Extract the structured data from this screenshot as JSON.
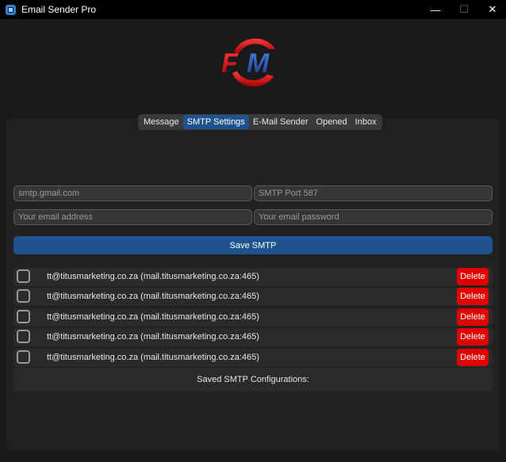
{
  "window": {
    "title": "Email Sender Pro",
    "minimize": "—",
    "maximize": "☐",
    "close": "✕"
  },
  "logo": {
    "text": "FM"
  },
  "tabs": [
    {
      "label": "Message"
    },
    {
      "label": "SMTP Settings"
    },
    {
      "label": "E-Mail Sender"
    },
    {
      "label": "Opened"
    },
    {
      "label": "Inbox"
    }
  ],
  "form": {
    "smtp_host_placeholder": "smtp.gmail.com",
    "smtp_port_placeholder": "SMTP Port 587",
    "email_placeholder": "Your email address",
    "password_placeholder": "Your email password",
    "save_label": "Save SMTP"
  },
  "smtp_list": [
    {
      "text": "tt@titusmarketing.co.za (mail.titusmarketing.co.za:465)",
      "delete_label": "Delete"
    },
    {
      "text": "tt@titusmarketing.co.za (mail.titusmarketing.co.za:465)",
      "delete_label": "Delete"
    },
    {
      "text": "tt@titusmarketing.co.za (mail.titusmarketing.co.za:465)",
      "delete_label": "Delete"
    },
    {
      "text": "tt@titusmarketing.co.za (mail.titusmarketing.co.za:465)",
      "delete_label": "Delete"
    },
    {
      "text": "tt@titusmarketing.co.za (mail.titusmarketing.co.za:465)",
      "delete_label": "Delete"
    }
  ],
  "saved_configs_label": "Saved SMTP Configurations:"
}
